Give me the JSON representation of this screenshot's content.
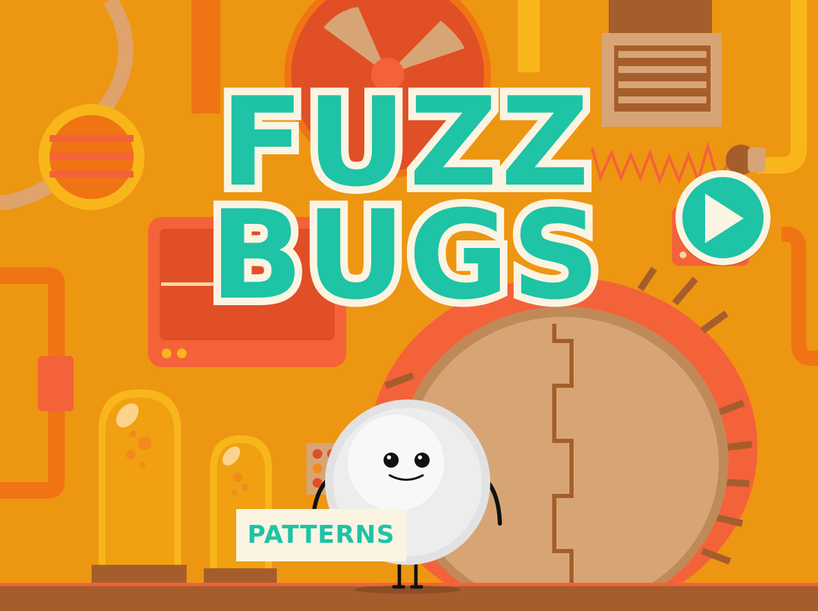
{
  "game": {
    "title_line1": "FUZZ",
    "title_line2": "BUGS",
    "mode_label": "PATTERNS",
    "play_icon": "play-icon"
  },
  "colors": {
    "background": "#ED9612",
    "title_teal": "#1FC3A6",
    "cream": "#FBF4E2",
    "floor": "#A65D2C",
    "accent_red": "#F4623A",
    "door_tan": "#D7A575"
  }
}
